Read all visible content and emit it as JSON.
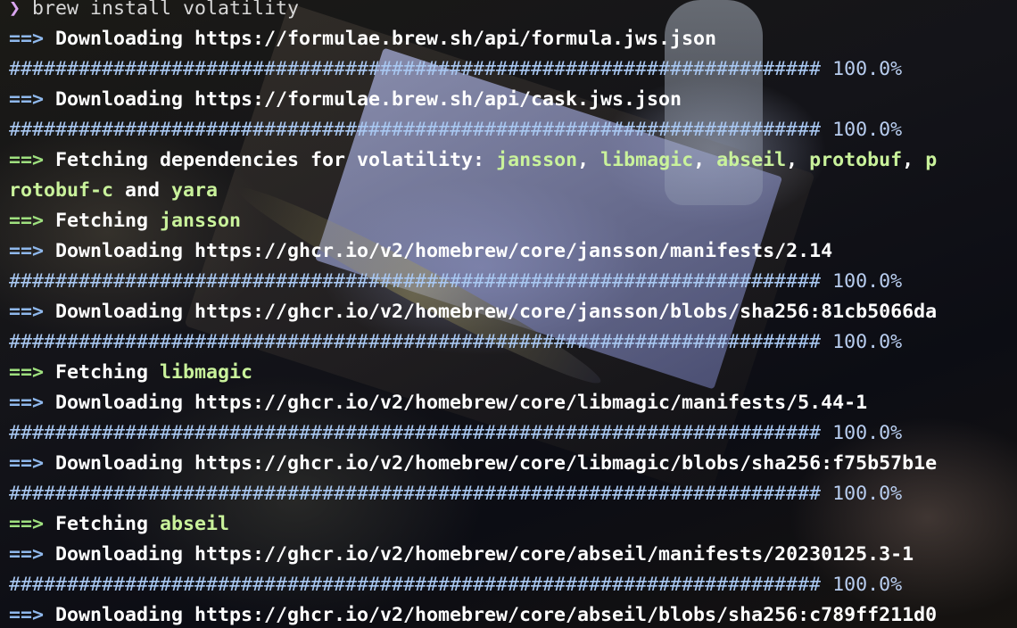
{
  "command": {
    "prompt_symbol": "❯",
    "text": "brew install volatility"
  },
  "progress_bar": {
    "hashes": "######################################################################",
    "percent": "100.0%"
  },
  "lines": {
    "l1": {
      "arrow": "==>",
      "text": "Downloading https://formulae.brew.sh/api/formula.jws.json"
    },
    "l3": {
      "arrow": "==>",
      "text": "Downloading https://formulae.brew.sh/api/cask.jws.json"
    },
    "l5": {
      "arrow": "==>",
      "text": "Fetching dependencies for volatility: ",
      "deps": [
        "jansson",
        "libmagic",
        "abseil",
        "protobuf",
        "p"
      ],
      "sep": ", ",
      "cont_dep": "rotobuf-c",
      "and": " and ",
      "last_dep": "yara"
    },
    "l7": {
      "arrow": "==>",
      "text": "Fetching ",
      "name": "jansson"
    },
    "l8": {
      "arrow": "==>",
      "text": "Downloading https://ghcr.io/v2/homebrew/core/jansson/manifests/2.14"
    },
    "l10": {
      "arrow": "==>",
      "text": "Downloading https://ghcr.io/v2/homebrew/core/jansson/blobs/sha256:81cb5066da"
    },
    "l12": {
      "arrow": "==>",
      "text": "Fetching ",
      "name": "libmagic"
    },
    "l13": {
      "arrow": "==>",
      "text": "Downloading https://ghcr.io/v2/homebrew/core/libmagic/manifests/5.44-1"
    },
    "l15": {
      "arrow": "==>",
      "text": "Downloading https://ghcr.io/v2/homebrew/core/libmagic/blobs/sha256:f75b57b1e"
    },
    "l17": {
      "arrow": "==>",
      "text": "Fetching ",
      "name": "abseil"
    },
    "l18": {
      "arrow": "==>",
      "text": "Downloading https://ghcr.io/v2/homebrew/core/abseil/manifests/20230125.3-1"
    },
    "l20": {
      "arrow": "==>",
      "text": "Downloading https://ghcr.io/v2/homebrew/core/abseil/blobs/sha256:c789ff211d0"
    }
  }
}
